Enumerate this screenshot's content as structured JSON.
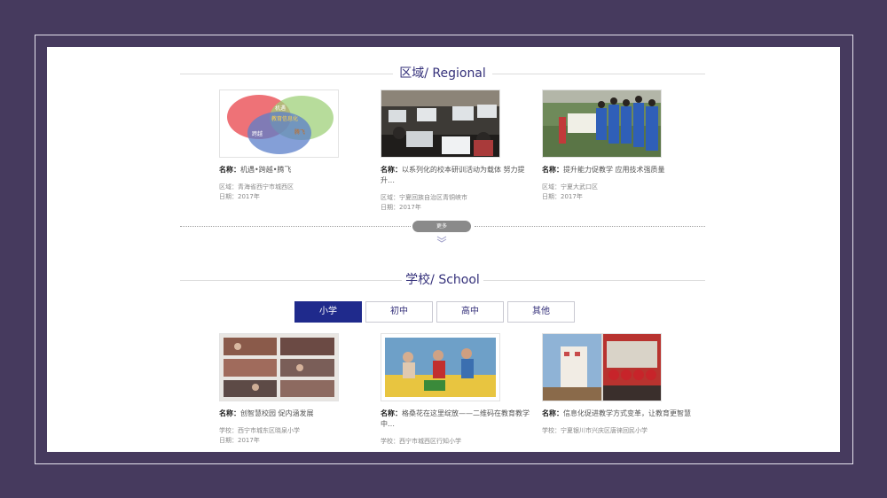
{
  "regional": {
    "title": "区域/ Regional",
    "more": "更多",
    "items": [
      {
        "name_label": "名称：",
        "name": "机遇•跨越•腾飞",
        "region": "区域：青海省西宁市城西区",
        "date": "日期：2017年",
        "venn": [
          "机遇",
          "教育信息化",
          "跨越",
          "腾飞"
        ]
      },
      {
        "name_label": "名称：",
        "name": "以系列化的校本研训活动为载体 努力提升…",
        "region": "区域：宁夏回族自治区青铜峡市",
        "date": "日期：2017年"
      },
      {
        "name_label": "名称：",
        "name": "提升能力促教学 应用技术强质量",
        "region": "区域：宁夏大武口区",
        "date": "日期：2017年"
      }
    ]
  },
  "school": {
    "title": "学校/ School",
    "tabs": [
      "小学",
      "初中",
      "高中",
      "其他"
    ],
    "active_tab": "小学",
    "items": [
      {
        "name_label": "名称：",
        "name": "创智慧校园 促内涵发展",
        "school": "学校：西宁市城东区晓泉小学",
        "date": "日期：2017年"
      },
      {
        "name_label": "名称：",
        "name": "格桑花在这里绽放——二维码在教育教学中…",
        "school": "学校：西宁市城西区行知小学"
      },
      {
        "name_label": "名称：",
        "name": "信息化促进教学方式变革，让教育更智慧",
        "school": "学校：宁夏银川市兴庆区唐徕回民小学"
      }
    ]
  },
  "colors": {
    "backdrop": "#463a5e",
    "heading": "#34307a",
    "active_tab": "#1f2a8c"
  }
}
